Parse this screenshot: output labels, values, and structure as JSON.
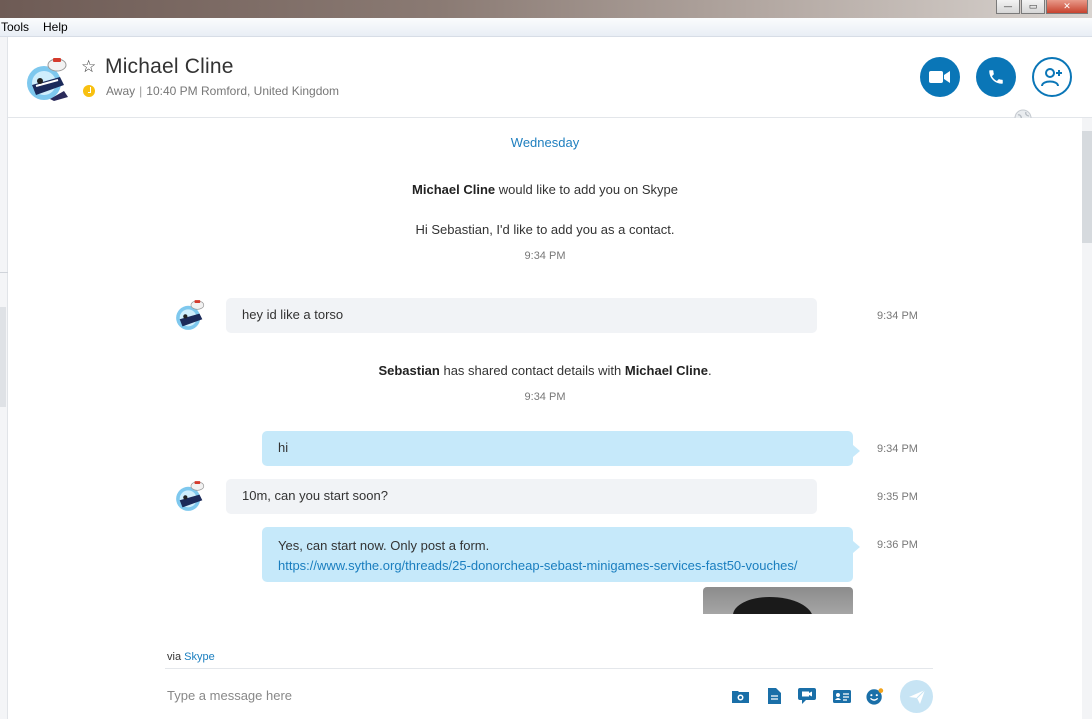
{
  "menu": {
    "items": [
      "Tools",
      "Help"
    ]
  },
  "window_controls": {
    "minimize": "—",
    "maximize": "▭",
    "close": "✕"
  },
  "header": {
    "contact_name": "Michael Cline",
    "status": "Away",
    "local_time": "10:40 PM",
    "location": "Romford, United Kingdom",
    "status_separator": "|"
  },
  "conversation": {
    "day_label": "Wednesday",
    "request": {
      "name": "Michael Cline",
      "text": " would like to add you on Skype"
    },
    "request_message": "Hi Sebastian, I'd like to add you as a contact.",
    "request_time": "9:34 PM",
    "messages": [
      {
        "direction": "in",
        "text": "hey id like a torso",
        "time": "9:34 PM"
      },
      {
        "direction": "out",
        "text": "hi",
        "time": "9:34 PM"
      },
      {
        "direction": "in",
        "text": "10m, can you start soon?",
        "time": "9:35 PM"
      },
      {
        "direction": "out",
        "text": "Yes, can start now. Only post a form.",
        "link": "https://www.sythe.org/threads/25-donorcheap-sebast-minigames-services-fast50-vouches/",
        "time": "9:36 PM"
      }
    ],
    "shared": {
      "from": "Sebastian",
      "text": " has shared contact details with ",
      "to": "Michael Cline",
      "end": ".",
      "time": "9:34 PM"
    }
  },
  "footer": {
    "via_prefix": "via ",
    "via_name": "Skype",
    "compose_placeholder": "Type a message here"
  },
  "colors": {
    "accent": "#0a76b7",
    "outgoing_bubble": "#c6e9fa",
    "incoming_bubble": "#f1f3f6",
    "away": "#f8c010",
    "link": "#1a7ebf"
  }
}
